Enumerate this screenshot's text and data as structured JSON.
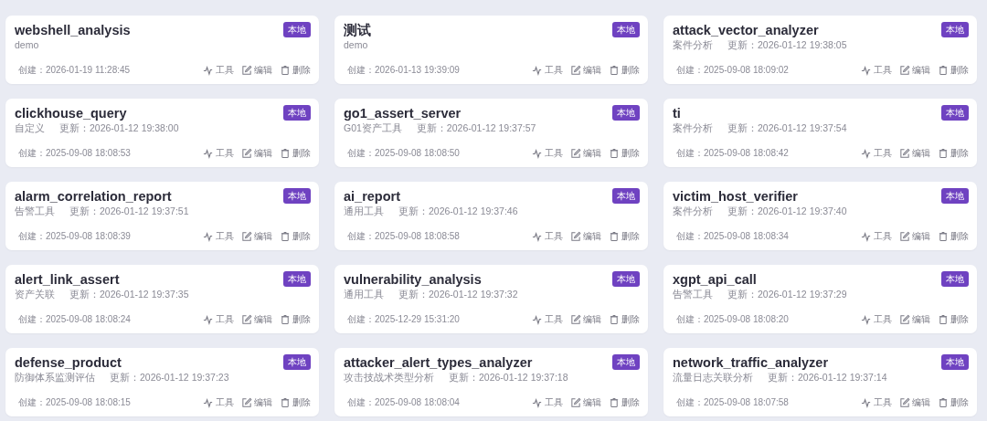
{
  "cards": [
    {
      "name": "webshell_analysis",
      "badge": "本地",
      "category": "demo",
      "created": "创建：2026-01-19 11:28:45",
      "actions": [
        "工具",
        "编辑",
        "删除"
      ]
    },
    {
      "name": "测试",
      "badge": "本地",
      "category": "demo",
      "created": "创建：2026-01-13 19:39:09",
      "actions": [
        "工具",
        "编辑",
        "删除"
      ]
    },
    {
      "name": "attack_vector_analyzer",
      "badge": "本地",
      "category": "案件分析",
      "updated": "更新：2026-01-12 19:38:05",
      "created": "创建：2025-09-08 18:09:02",
      "actions": [
        "工具",
        "编辑",
        "删除"
      ]
    },
    {
      "name": "clickhouse_query",
      "badge": "本地",
      "category": "自定义",
      "updated": "更新：2026-01-12 19:38:00",
      "created": "创建：2025-09-08 18:08:53",
      "actions": [
        "工具",
        "编辑",
        "删除"
      ]
    },
    {
      "name": "go1_assert_server",
      "badge": "本地",
      "category": "G01资产工具",
      "updated": "更新：2026-01-12 19:37:57",
      "created": "创建：2025-09-08 18:08:50",
      "actions": [
        "工具",
        "编辑",
        "删除"
      ]
    },
    {
      "name": "ti",
      "badge": "本地",
      "category": "案件分析",
      "updated": "更新：2026-01-12 19:37:54",
      "created": "创建：2025-09-08 18:08:42",
      "actions": [
        "工具",
        "编辑",
        "删除"
      ]
    },
    {
      "name": "alarm_correlation_report",
      "badge": "本地",
      "category": "告警工具",
      "updated": "更新：2026-01-12 19:37:51",
      "created": "创建：2025-09-08 18:08:39",
      "actions": [
        "工具",
        "编辑",
        "删除"
      ]
    },
    {
      "name": "ai_report",
      "badge": "本地",
      "category": "通用工具",
      "updated": "更新：2026-01-12 19:37:46",
      "created": "创建：2025-09-08 18:08:58",
      "actions": [
        "工具",
        "编辑",
        "删除"
      ]
    },
    {
      "name": "victim_host_verifier",
      "badge": "本地",
      "category": "案件分析",
      "updated": "更新：2026-01-12 19:37:40",
      "created": "创建：2025-09-08 18:08:34",
      "actions": [
        "工具",
        "编辑",
        "删除"
      ]
    },
    {
      "name": "alert_link_assert",
      "badge": "本地",
      "category": "资产关联",
      "updated": "更新：2026-01-12 19:37:35",
      "created": "创建：2025-09-08 18:08:24",
      "actions": [
        "工具",
        "编辑",
        "删除"
      ]
    },
    {
      "name": "vulnerability_analysis",
      "badge": "本地",
      "category": "通用工具",
      "updated": "更新：2026-01-12 19:37:32",
      "created": "创建：2025-12-29 15:31:20",
      "actions": [
        "工具",
        "编辑",
        "删除"
      ]
    },
    {
      "name": "xgpt_api_call",
      "badge": "本地",
      "category": "告警工具",
      "updated": "更新：2026-01-12 19:37:29",
      "created": "创建：2025-09-08 18:08:20",
      "actions": [
        "工具",
        "编辑",
        "删除"
      ]
    },
    {
      "name": "defense_product",
      "badge": "本地",
      "category": "防御体系监测评估",
      "updated": "更新：2026-01-12 19:37:23",
      "created": "创建：2025-09-08 18:08:15",
      "actions": [
        "工具",
        "编辑",
        "删除"
      ]
    },
    {
      "name": "attacker_alert_types_analyzer",
      "badge": "本地",
      "category": "攻击技战术类型分析",
      "updated": "更新：2026-01-12 19:37:18",
      "created": "创建：2025-09-08 18:08:04",
      "actions": [
        "工具",
        "编辑",
        "删除"
      ]
    },
    {
      "name": "network_traffic_analyzer",
      "badge": "本地",
      "category": "流量日志关联分析",
      "updated": "更新：2026-01-12 19:37:14",
      "created": "创建：2025-09-08 18:07:58",
      "actions": [
        "工具",
        "编辑",
        "删除"
      ]
    }
  ]
}
